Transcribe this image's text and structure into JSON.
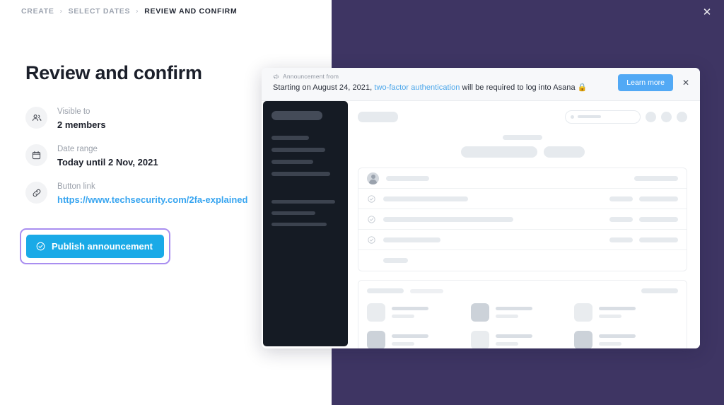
{
  "breadcrumb": {
    "items": [
      {
        "label": "CREATE",
        "active": false
      },
      {
        "label": "SELECT DATES",
        "active": false
      },
      {
        "label": "REVIEW AND CONFIRM",
        "active": true
      }
    ],
    "separator": "›"
  },
  "page": {
    "title": "Review and confirm"
  },
  "details": [
    {
      "icon": "people-icon",
      "label": "Visible to",
      "value": "2 members",
      "is_link": false
    },
    {
      "icon": "calendar-icon",
      "label": "Date range",
      "value": "Today until 2 Nov, 2021",
      "is_link": false
    },
    {
      "icon": "link-icon",
      "label": "Button link",
      "value": "https://www.techsecurity.com/2fa-explained",
      "is_link": true
    }
  ],
  "publish": {
    "label": "Publish announcement",
    "icon": "check-circle-icon",
    "background": "#1aaae7",
    "focus_ring": "#a98ef0"
  },
  "window": {
    "close_label": "✕",
    "backdrop_color": "#3e3563"
  },
  "preview": {
    "banner": {
      "kicker": "Announcement from",
      "kicker_icon": "megaphone-icon",
      "text_before": "Starting on August 24, 2021, ",
      "link_text": "two-factor authentication",
      "text_after": " will be required to log into Asana ",
      "trailing_emoji": "🔒",
      "learn_more_label": "Learn more",
      "learn_more_color": "#52a9f5",
      "close_label": "✕"
    }
  }
}
